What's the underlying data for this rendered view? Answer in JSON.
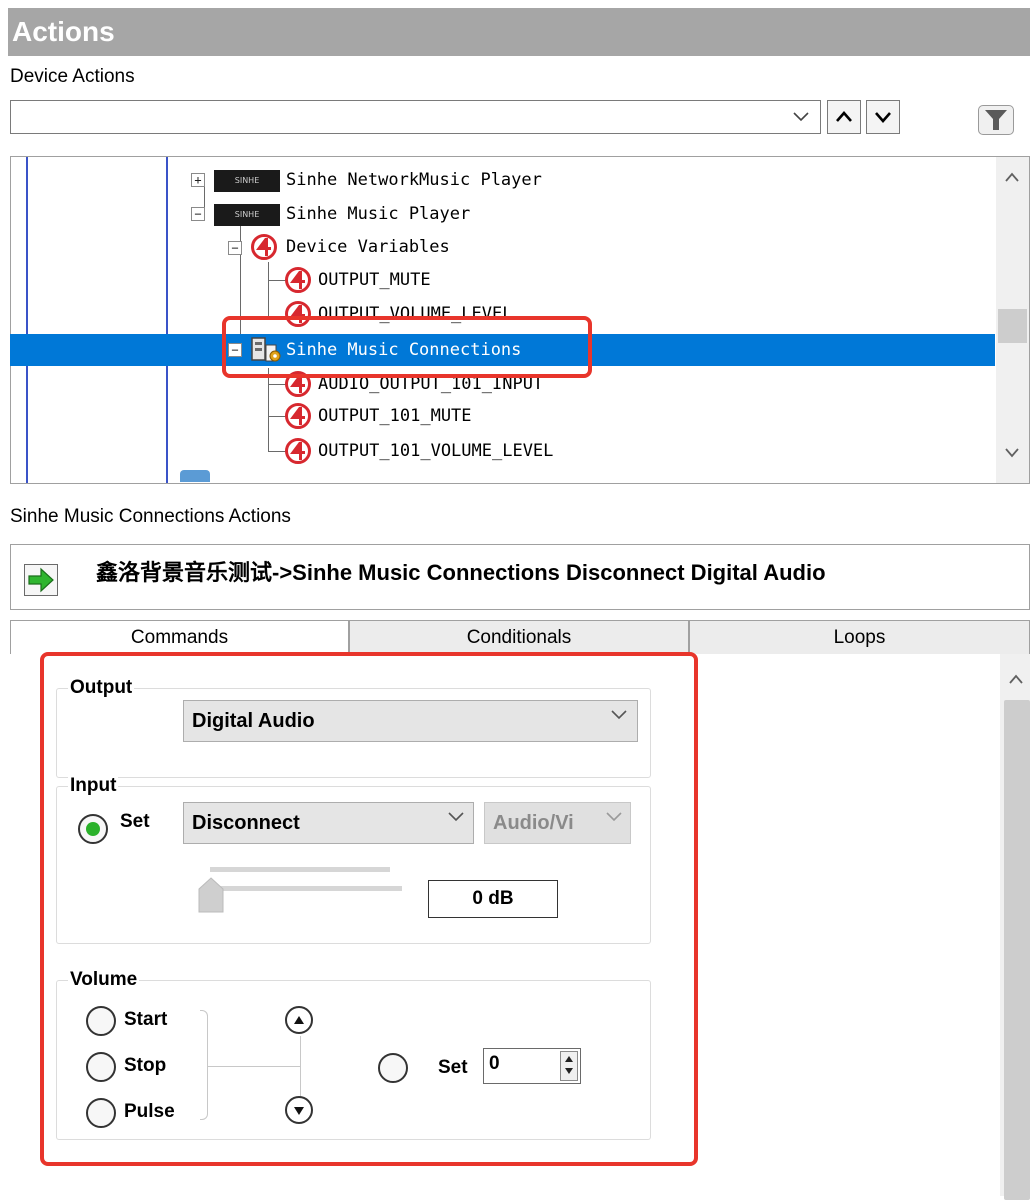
{
  "header": {
    "title": "Actions"
  },
  "section_label": "Device Actions",
  "filter": {
    "value": "",
    "dropdown_icon": "chevron-down-icon"
  },
  "tree": {
    "items": [
      {
        "label": "Sinhe NetworkMusic Player",
        "expander": "+",
        "icon": "logo-badge"
      },
      {
        "label": "Sinhe Music Player",
        "expander": "−",
        "icon": "logo-badge"
      },
      {
        "label": "Device Variables",
        "expander": "−",
        "icon": "control4-icon"
      },
      {
        "label": "OUTPUT_MUTE",
        "icon": "control4-icon"
      },
      {
        "label": "OUTPUT_VOLUME_LEVEL",
        "icon": "control4-icon"
      },
      {
        "label": "Sinhe Music Connections",
        "expander": "−",
        "icon": "connections-icon",
        "selected": true
      },
      {
        "label": "AUDIO_OUTPUT_101_INPUT",
        "icon": "control4-icon"
      },
      {
        "label": "OUTPUT_101_MUTE",
        "icon": "control4-icon"
      },
      {
        "label": "OUTPUT_101_VOLUME_LEVEL",
        "icon": "control4-icon"
      }
    ],
    "selection_color": "#0078d7"
  },
  "actions_label": "Sinhe Music Connections Actions",
  "command": {
    "text": "鑫洛背景音乐测试->Sinhe Music Connections Disconnect Digital Audio"
  },
  "tabs": [
    {
      "label": "Commands",
      "active": true
    },
    {
      "label": "Conditionals"
    },
    {
      "label": "Loops"
    }
  ],
  "output_group": {
    "title": "Output",
    "selected": "Digital Audio"
  },
  "input_group": {
    "title": "Input",
    "set_label": "Set",
    "selected": "Disconnect",
    "secondary_selected": "Audio/Vi",
    "level_text": "0 dB"
  },
  "volume_group": {
    "title": "Volume",
    "start_label": "Start",
    "stop_label": "Stop",
    "pulse_label": "Pulse",
    "set_label": "Set",
    "set_value": "0"
  },
  "colors": {
    "highlight": "#e8352b",
    "header_bg": "#a6a6a6",
    "accent": "#0078d7",
    "control4_red": "#d7282f"
  }
}
